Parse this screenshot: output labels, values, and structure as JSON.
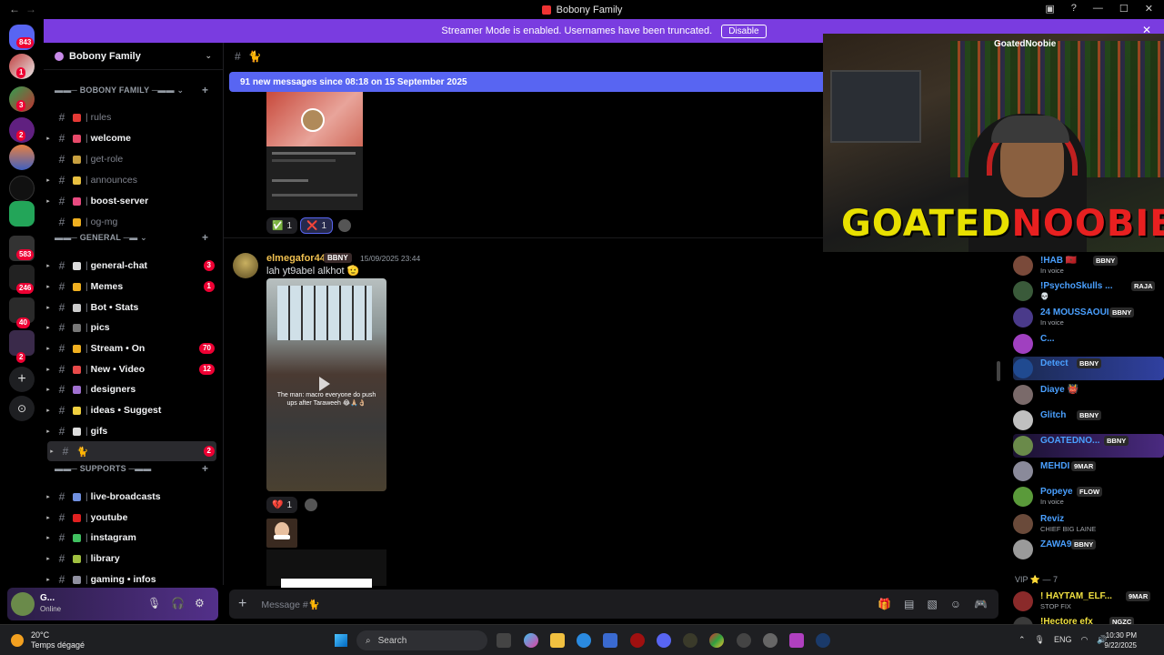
{
  "window": {
    "title": "Bobony Family"
  },
  "banner": {
    "text": "Streamer Mode is enabled. Usernames have been truncated.",
    "disable_label": "Disable"
  },
  "rail": {
    "home_badge": "843",
    "badges": [
      "1",
      "3",
      "2",
      "583",
      "246",
      "40",
      "2"
    ]
  },
  "guild": {
    "name": "Bobony Family"
  },
  "categories": {
    "bobony": "BOBONY FAMILY",
    "general": "GENERAL",
    "supports": "SUPPORTS"
  },
  "channels": [
    {
      "name": "rules",
      "muted": true,
      "emoji_color": "#e53935"
    },
    {
      "name": "welcome",
      "muted": false,
      "emoji_color": "#e84a6a"
    },
    {
      "name": "get-role",
      "muted": true,
      "emoji_color": "#c8a040"
    },
    {
      "name": "announces",
      "muted": true,
      "emoji_color": "#e8c040"
    },
    {
      "name": "boost-server",
      "muted": false,
      "emoji_color": "#e84a80"
    },
    {
      "name": "og-mg",
      "muted": true,
      "emoji_color": "#f0b020"
    },
    {
      "name": "general-chat",
      "muted": false,
      "emoji_color": "#dddddd",
      "badge": "3"
    },
    {
      "name": "Memes",
      "muted": false,
      "emoji_color": "#f0b020",
      "badge": "1"
    },
    {
      "name": "Bot • Stats",
      "muted": false,
      "emoji_color": "#cccccc"
    },
    {
      "name": "pics",
      "muted": false,
      "emoji_color": "#777777"
    },
    {
      "name": "Stream • On",
      "muted": false,
      "emoji_color": "#f0b020",
      "badge": "70"
    },
    {
      "name": "New • Video",
      "muted": false,
      "emoji_color": "#e84a4a",
      "badge": "12"
    },
    {
      "name": "designers",
      "muted": false,
      "emoji_color": "#a070d0"
    },
    {
      "name": "ideas • Suggest",
      "muted": false,
      "emoji_color": "#f0d040"
    },
    {
      "name": "gifs",
      "muted": false,
      "emoji_color": "#dddddd"
    },
    {
      "name": "🐈",
      "muted": false,
      "emoji_color": "",
      "badge": "2",
      "active": true
    },
    {
      "name": "live-broadcasts",
      "muted": false,
      "emoji_color": "#7090e0"
    },
    {
      "name": "youtube",
      "muted": false,
      "emoji_color": "#e02020"
    },
    {
      "name": "instagram",
      "muted": false,
      "emoji_color": "#40c060"
    },
    {
      "name": "library",
      "muted": false,
      "emoji_color": "#a0c040"
    },
    {
      "name": "gaming • infos",
      "muted": false,
      "emoji_color": "#9090a0"
    }
  ],
  "user": {
    "name": "G...",
    "status": "Online"
  },
  "chat": {
    "channel_name": "🐈",
    "new_messages": "91 new messages since 08:18 on 15 September 2025",
    "reactions_top": [
      {
        "emoji": "✅",
        "count": "1"
      },
      {
        "emoji": "❌",
        "count": "1"
      }
    ],
    "message": {
      "author": "elmegafor44",
      "tag": "BBNY",
      "time": "15/09/2025 23:44",
      "text": "lah yt9abel alkhot 🫡",
      "video_caption": "The man: macro everyone do push ups after Taraweeh 😂🙏🏼👌🏼",
      "reaction": {
        "emoji": "💔",
        "count": "1"
      }
    },
    "input_placeholder": "Message #🐈"
  },
  "cam": {
    "logo_a": "GOATED",
    "logo_b": "NOOBIE",
    "tag": "GoatedNoobie"
  },
  "members": [
    {
      "name": "!HAB 🇲🇦",
      "tag": "BBNY",
      "sub": "In voice",
      "color": "#4aa0ff",
      "av": "#7a4a3a"
    },
    {
      "name": "!PsychoSkulls ...",
      "tag": "RAJA",
      "sub": "💀",
      "color": "#4aa0ff",
      "av": "#3a5a3a"
    },
    {
      "name": "24 MOUSSAOUI",
      "tag": "BBNY",
      "sub": "In voice",
      "color": "#4aa0ff",
      "av": "#4a3a8a"
    },
    {
      "name": "C...",
      "tag": "",
      "sub": "",
      "color": "#4aa0ff",
      "av": "#a040c0"
    },
    {
      "name": "Detect",
      "tag": "BBNY",
      "sub": "",
      "color": "#4aa0ff",
      "av": "#204a90",
      "hl": true
    },
    {
      "name": "Diaye 👹",
      "tag": "",
      "sub": "",
      "color": "#4aa0ff",
      "av": "#7a6a6a"
    },
    {
      "name": "Glitch",
      "tag": "BBNY",
      "sub": "",
      "color": "#4aa0ff",
      "av": "#c0c0c0"
    },
    {
      "name": "GOATEDNO...",
      "tag": "BBNY",
      "sub": "",
      "color": "#4aa0ff",
      "av": "#6a8a4a",
      "hl2": true
    },
    {
      "name": "MEHDI",
      "tag": "9MAR",
      "sub": "",
      "color": "#4aa0ff",
      "av": "#8a8a9a"
    },
    {
      "name": "Popeye",
      "tag": "FLOW",
      "sub": "In voice",
      "color": "#4aa0ff",
      "av": "#5a9a3a"
    },
    {
      "name": "Reviz",
      "tag": "",
      "sub": "CHIEF BIG LAINE",
      "color": "#4aa0ff",
      "av": "#6a4a3a"
    },
    {
      "name": "ZAWA9",
      "tag": "BBNY",
      "sub": "",
      "color": "#4aa0ff",
      "av": "#9a9a9a"
    }
  ],
  "vip": {
    "label": "VIP ⭐ — 7"
  },
  "vip_members": [
    {
      "name": "! HAYTAM_ELF...",
      "tag": "9MAR",
      "sub": "STOP FIX",
      "color": "#f0e040",
      "av": "#8a2a2a"
    },
    {
      "name": "!Hectore efx",
      "tag": "NGZC",
      "sub": "",
      "color": "#f0e040",
      "av": "#3a3a3a"
    }
  ],
  "taskbar": {
    "temp": "20°C",
    "weather": "Temps dégagé",
    "search": "Search",
    "lang": "ENG",
    "time": "10:30 PM",
    "date": "9/22/2025"
  }
}
